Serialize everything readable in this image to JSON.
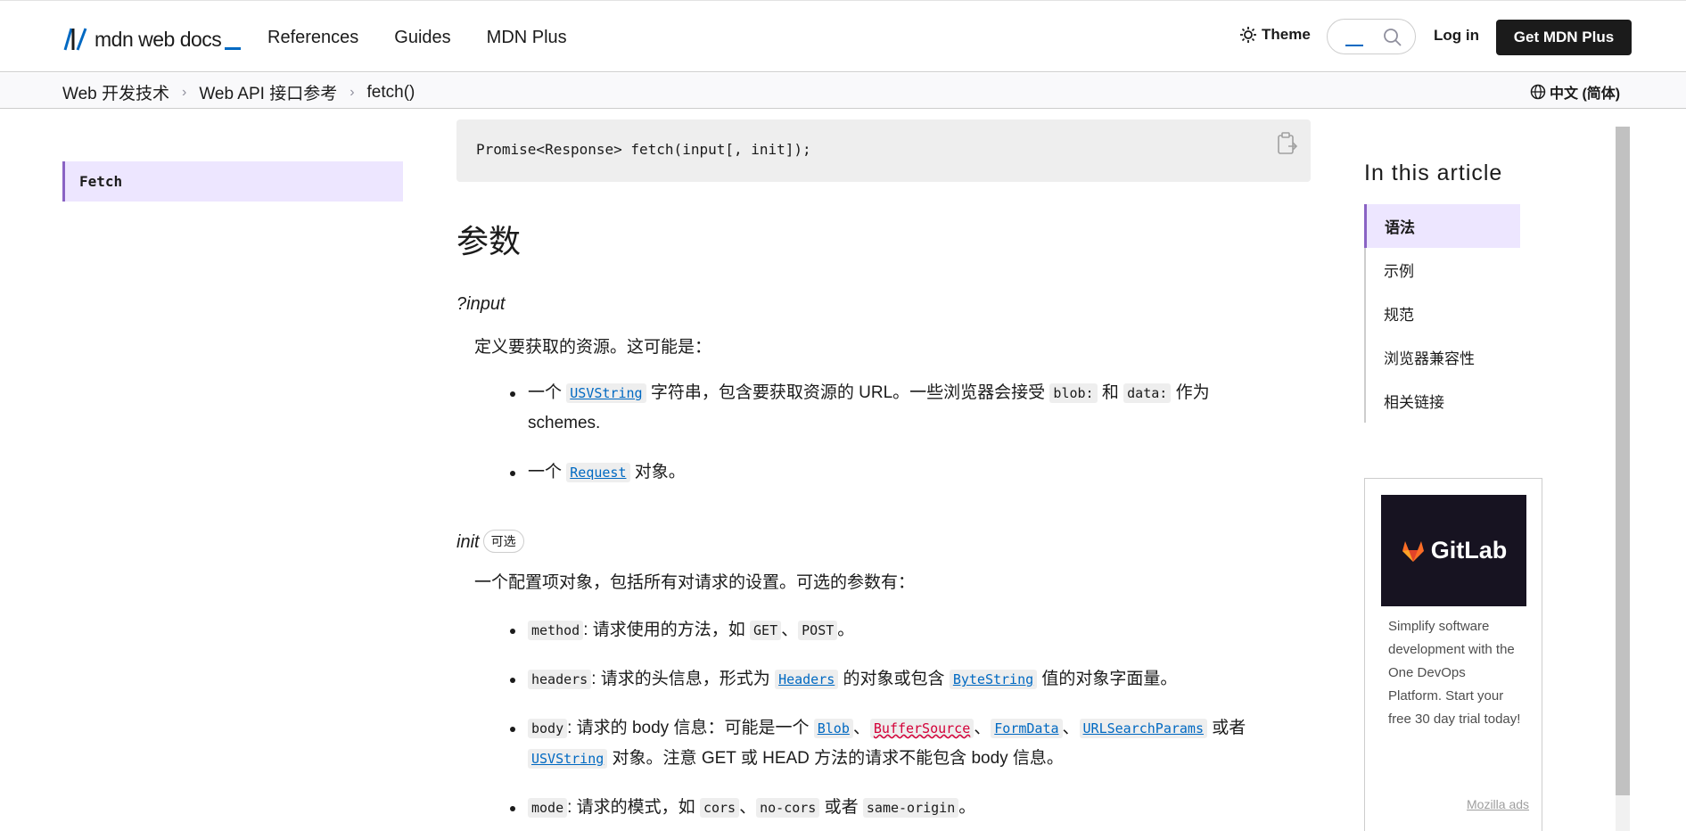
{
  "header": {
    "logo_text": "mdn web docs",
    "nav": [
      "References",
      "Guides",
      "MDN Plus"
    ],
    "theme_label": "Theme",
    "login_label": "Log in",
    "get_plus_label": "Get MDN Plus"
  },
  "breadcrumb": {
    "items": [
      "Web 开发技术",
      "Web API 接口参考",
      "fetch()"
    ],
    "language": "中文 (简体)"
  },
  "sidebar": {
    "active_item": "Fetch"
  },
  "main": {
    "syntax_code": "Promise<Response> fetch(input[, init]);",
    "section_heading": "参数",
    "input_term": "?input",
    "input_desc": "定义要获取的资源。这可能是：",
    "input_items": {
      "item1_pre": "一个 ",
      "item1_link": "USVString",
      "item1_mid": " 字符串，包含要获取资源的 URL。一些浏览器会接受 ",
      "item1_code1": "blob:",
      "item1_and": " 和 ",
      "item1_code2": "data:",
      "item1_post": " 作为",
      "item1_line2": "schemes.",
      "item2_pre": "一个 ",
      "item2_link": "Request",
      "item2_post": " 对象。"
    },
    "init_term": "init",
    "init_badge": "可选",
    "init_desc": "一个配置项对象，包括所有对请求的设置。可选的参数有：",
    "init_items": {
      "method_code": "method",
      "method_text": ": 请求使用的方法，如 ",
      "method_get": "GET",
      "sep1": "、",
      "method_post": "POST",
      "method_end": "。",
      "headers_code": "headers",
      "headers_text": ": 请求的头信息，形式为 ",
      "headers_link": "Headers",
      "headers_mid": " 的对象或包含 ",
      "headers_link2": "ByteString",
      "headers_end": " 值的对象字面量。",
      "body_code": "body",
      "body_text": ": 请求的 body 信息：可能是一个 ",
      "body_blob": "Blob",
      "body_buffer": "BufferSource",
      "body_form": "FormData",
      "body_url": "URLSearchParams",
      "body_or": " 或者",
      "body_usv": "USVString",
      "body_end": " 对象。注意 GET 或 HEAD 方法的请求不能包含 body 信息。",
      "mode_code": "mode",
      "mode_text": ": 请求的模式，如 ",
      "mode_cors": "cors",
      "mode_nocors": "no-cors",
      "mode_or": " 或者 ",
      "mode_same": "same-origin",
      "mode_end": "。"
    }
  },
  "toc": {
    "title": "In this article",
    "items": [
      "语法",
      "示例",
      "规范",
      "浏览器兼容性",
      "相关链接"
    ]
  },
  "ad": {
    "brand": "GitLab",
    "text": "Simplify software development with the One DevOps Platform. Start your free 30 day trial today!",
    "footer": "Mozilla ads"
  },
  "colors": {
    "accent_blue": "#0069c2",
    "active_purple_bg": "#ede6ff",
    "active_purple_border": "#8a63c4",
    "code_bg": "#eeeeee",
    "error_red": "#d30038"
  }
}
